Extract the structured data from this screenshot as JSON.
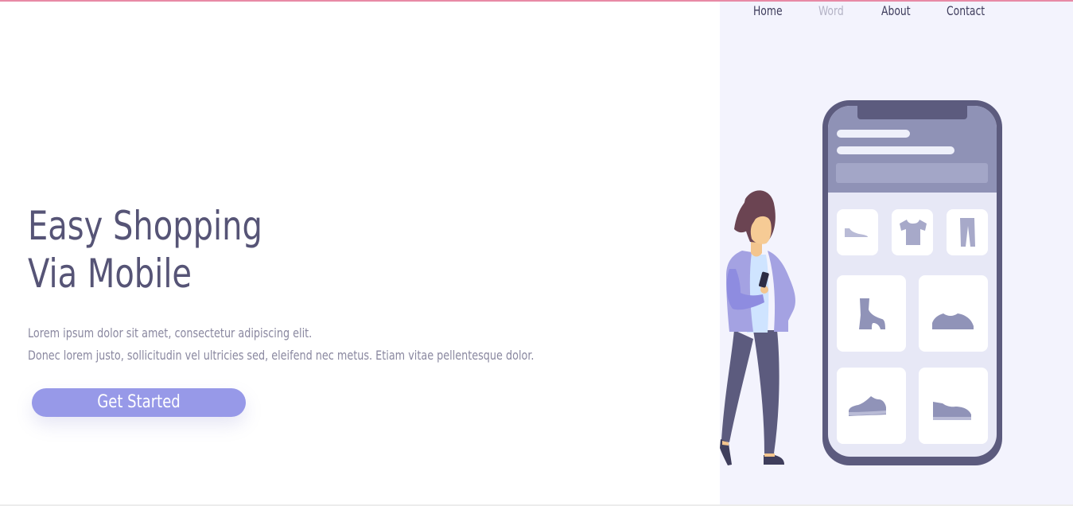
{
  "nav": {
    "links": [
      {
        "label": "Home",
        "active": false
      },
      {
        "label": "Word",
        "active": true
      },
      {
        "label": "About",
        "active": false
      },
      {
        "label": "Contact",
        "active": false
      }
    ]
  },
  "hero": {
    "title_line1": "Easy Shopping",
    "title_line2": "Via Mobile",
    "text_line1": "Lorem ipsum dolor sit amet, consectetur adipiscing elit.",
    "text_line2": "Donec lorem justo, sollicitudin vel ultricies sed, eleifend nec metus. Etiam vitae pellentesque dolor.",
    "cta_label": "Get Started"
  },
  "illustration": {
    "icons": [
      "flat-shoe-icon",
      "t-shirt-icon",
      "pants-icon",
      "boot-icon",
      "sneaker-icon",
      "sneaker-icon",
      "sneaker-icon"
    ]
  },
  "colors": {
    "accent": "#9799e8",
    "heading": "#565476",
    "body_text": "#8a88a0",
    "panel_bg": "#f3f3fd",
    "phone_frame": "#5c5b7e",
    "top_border": "#e88aa6"
  }
}
